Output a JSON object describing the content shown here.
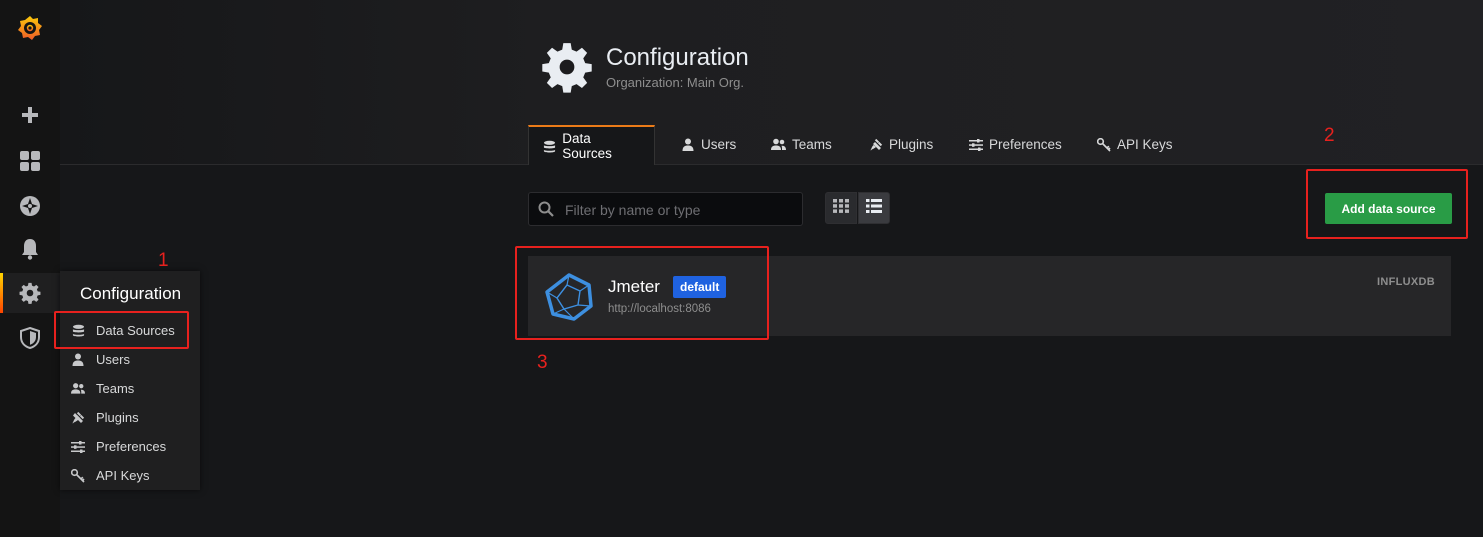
{
  "header": {
    "title": "Configuration",
    "subtitle": "Organization: Main Org."
  },
  "tabs": [
    {
      "label": "Data Sources",
      "icon": "database-icon",
      "active": true
    },
    {
      "label": "Users",
      "icon": "user-icon"
    },
    {
      "label": "Teams",
      "icon": "users-icon"
    },
    {
      "label": "Plugins",
      "icon": "plug-icon"
    },
    {
      "label": "Preferences",
      "icon": "sliders-icon"
    },
    {
      "label": "API Keys",
      "icon": "key-icon"
    }
  ],
  "filter": {
    "placeholder": "Filter by name or type"
  },
  "toolbar": {
    "add_label": "Add data source"
  },
  "datasource": {
    "name": "Jmeter",
    "badge": "default",
    "url": "http://localhost:8086",
    "type": "INFLUXDB"
  },
  "submenu": {
    "title": "Configuration",
    "items": [
      {
        "label": "Data Sources",
        "icon": "database-icon"
      },
      {
        "label": "Users",
        "icon": "user-icon"
      },
      {
        "label": "Teams",
        "icon": "users-icon"
      },
      {
        "label": "Plugins",
        "icon": "plug-icon"
      },
      {
        "label": "Preferences",
        "icon": "sliders-icon"
      },
      {
        "label": "API Keys",
        "icon": "key-icon"
      }
    ]
  },
  "annotations": [
    "1",
    "2",
    "3"
  ],
  "colors": {
    "accent": "#eb7b18",
    "primary_button": "#299c46",
    "badge": "#1f62e0",
    "annotation": "#e7211e"
  }
}
